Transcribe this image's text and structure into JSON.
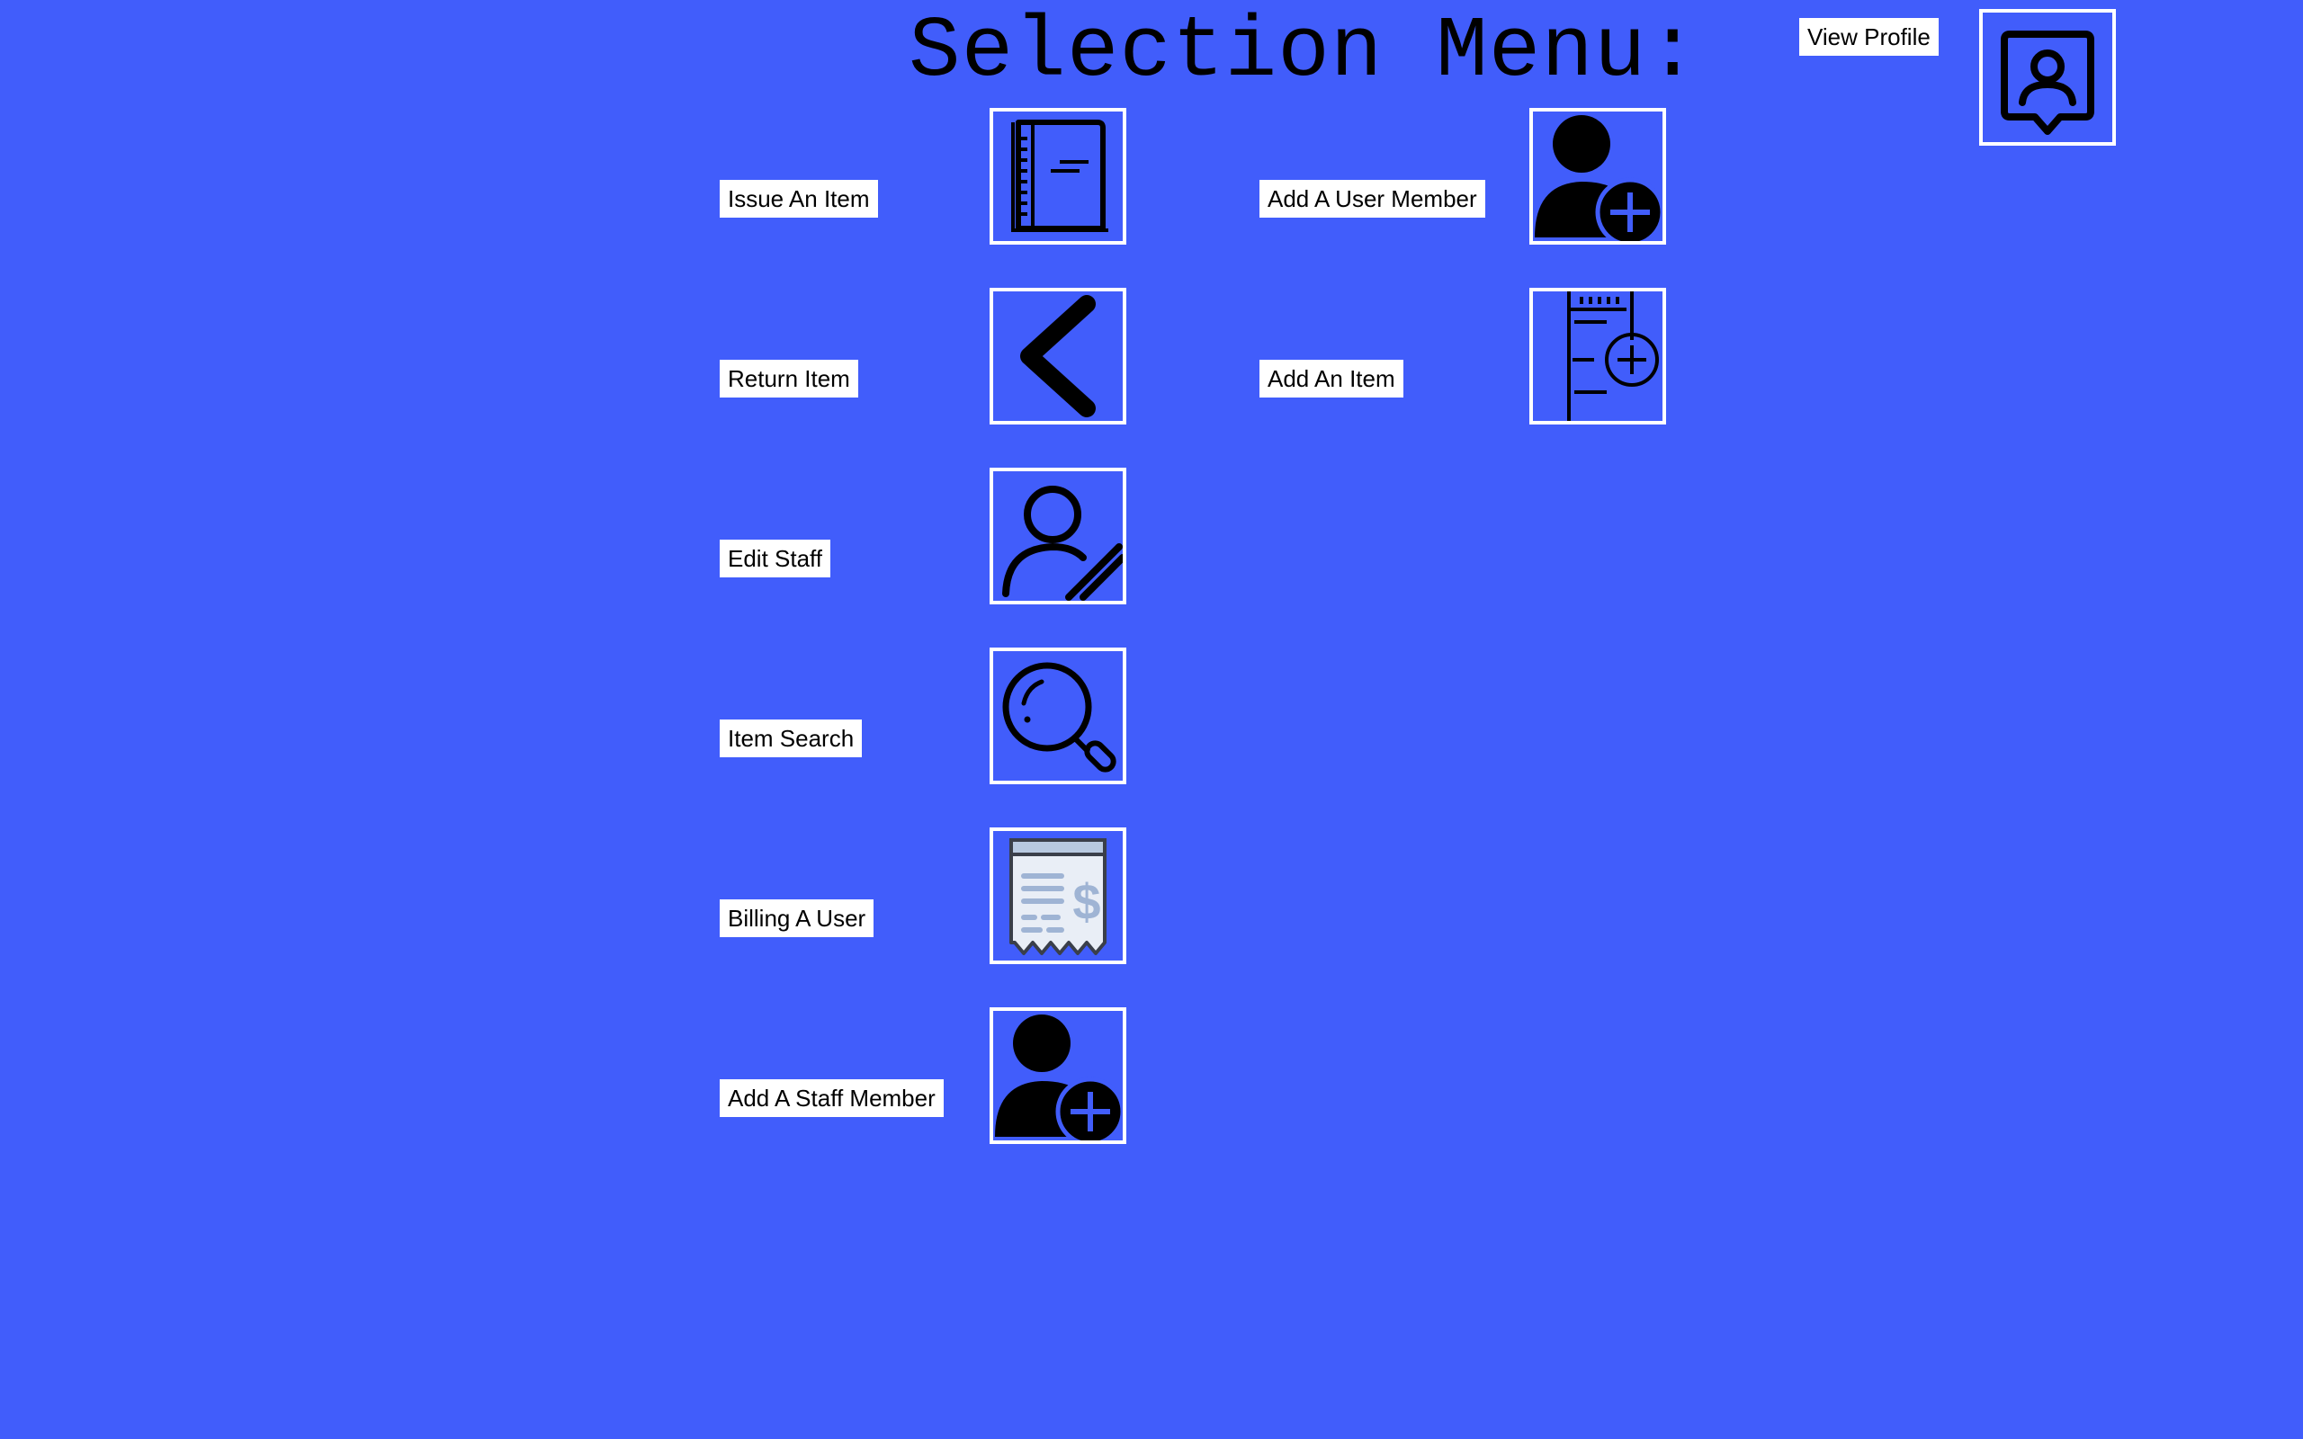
{
  "page": {
    "background_color": "#415dfb",
    "title": "Selection Menu:"
  },
  "header": {
    "view_profile_label": "View Profile",
    "view_profile_icon": "profile-chat-icon"
  },
  "menu_items": [
    {
      "label": "Issue An Item",
      "icon": "book-icon"
    },
    {
      "label": "Return Item",
      "icon": "chevron-left-icon"
    },
    {
      "label": "Edit Staff",
      "icon": "user-edit-icon"
    },
    {
      "label": "Item Search",
      "icon": "search-icon"
    },
    {
      "label": "Billing A User",
      "icon": "invoice-icon"
    },
    {
      "label": "Add A Staff Member",
      "icon": "user-add-icon"
    },
    {
      "label": "Add A User Member",
      "icon": "user-add-icon"
    },
    {
      "label": "Add An Item",
      "icon": "notebook-add-icon"
    }
  ]
}
